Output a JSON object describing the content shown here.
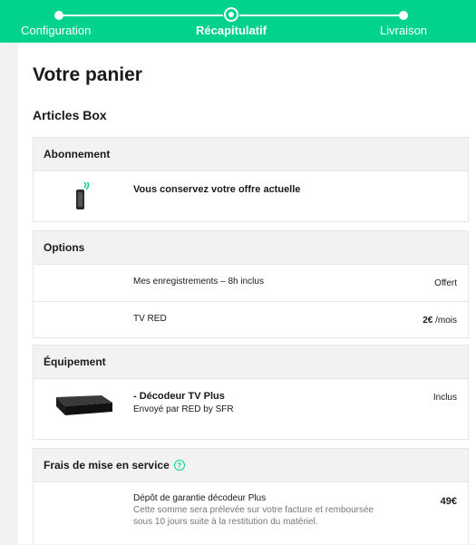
{
  "stepper": {
    "steps": [
      {
        "label": "Configuration",
        "state": "done"
      },
      {
        "label": "Récapitulatif",
        "state": "active"
      },
      {
        "label": "Livraison",
        "state": "todo"
      }
    ],
    "accent_color": "#01d28e"
  },
  "page": {
    "title": "Votre panier",
    "section_title": "Articles Box"
  },
  "abonnement": {
    "title": "Abonnement",
    "icon": "box-device-icon",
    "text": "Vous conservez votre offre actuelle"
  },
  "options": {
    "title": "Options",
    "items": [
      {
        "label": "Mes enregistrements – 8h inclus",
        "price": "Offert"
      },
      {
        "label": "TV RED",
        "price_amount": "2€",
        "price_unit": " /mois"
      }
    ]
  },
  "equipement": {
    "title": "Équipement",
    "item_title": "- Décodeur TV Plus",
    "item_subtitle": "Envoyé par RED by SFR",
    "price": "Inclus",
    "icon": "tv-decoder-icon"
  },
  "frais": {
    "title": "Frais de mise en service",
    "help_icon": "help-icon",
    "item_title": "Dépôt de garantie décodeur Plus",
    "item_desc_line1": "Cette somme sera prélevée sur votre facture et remboursée",
    "item_desc_line2": "sous 10 jours suite à la restitution du matériel.",
    "price": "49€"
  }
}
